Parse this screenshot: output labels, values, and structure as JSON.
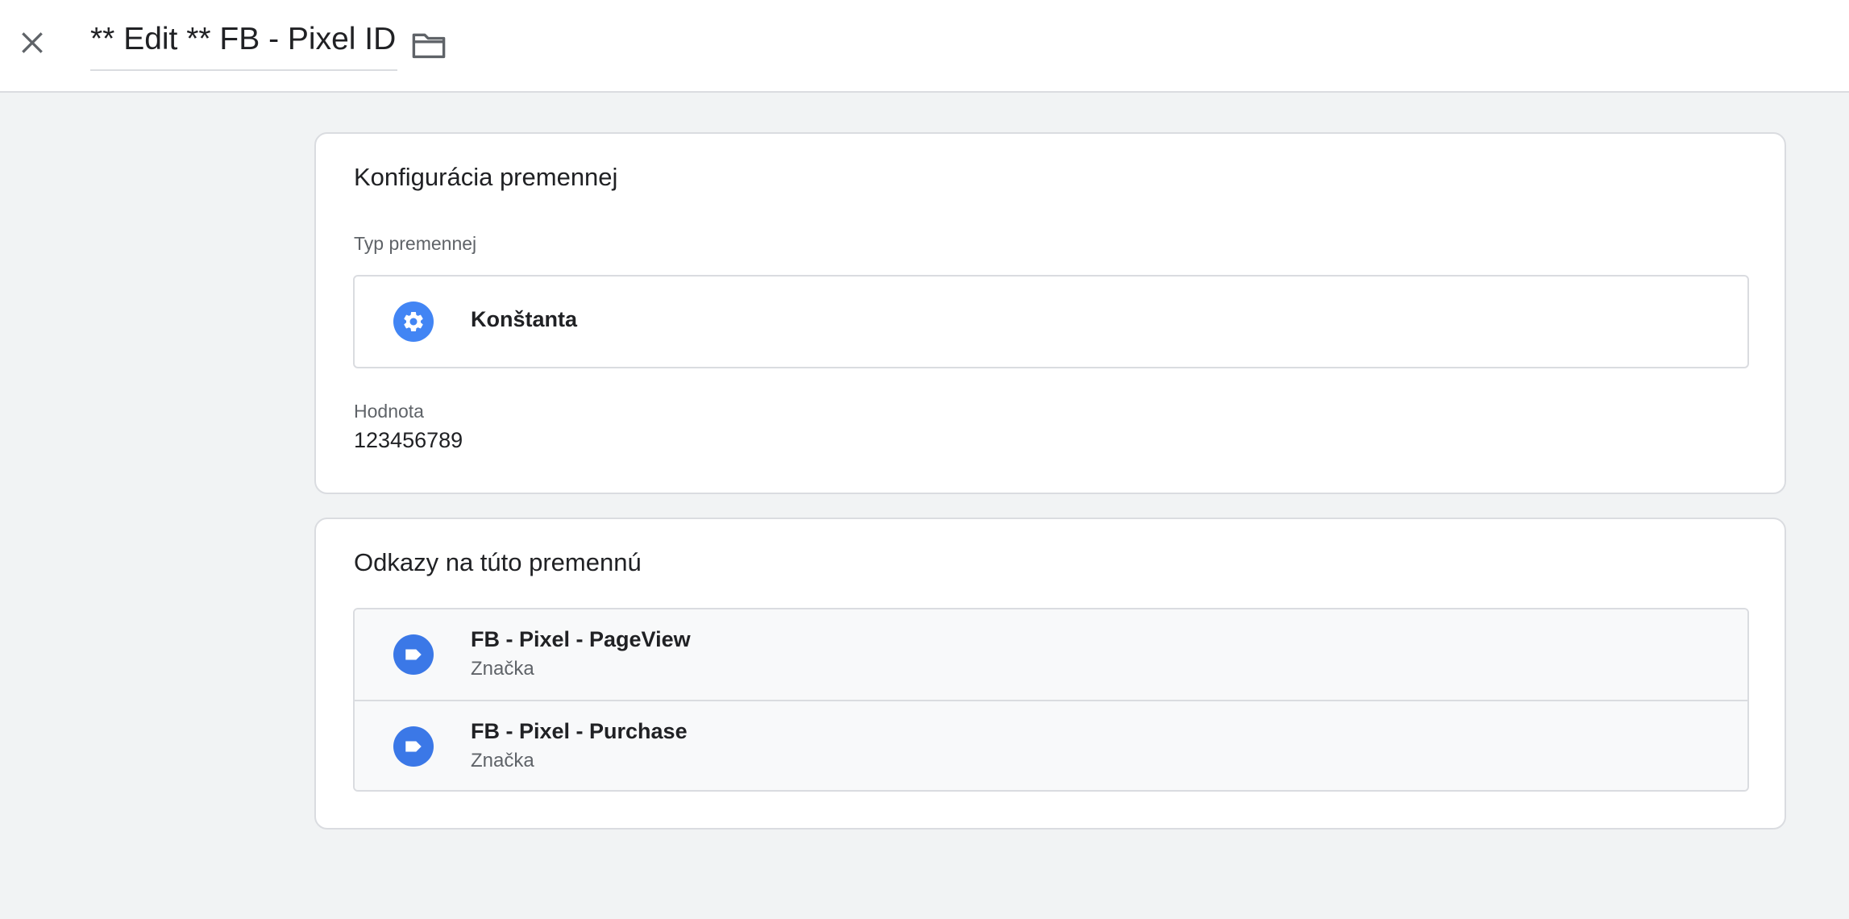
{
  "header": {
    "title": "** Edit ** FB - Pixel ID",
    "close_icon": "close-icon",
    "folder_icon": "folder-icon"
  },
  "config": {
    "title": "Konfigurácia premennej",
    "type_label": "Typ premennej",
    "type_name": "Konštanta",
    "type_icon": "gear-icon",
    "value_label": "Hodnota",
    "value": "123456789"
  },
  "references": {
    "title": "Odkazy na túto premennú",
    "items": [
      {
        "name": "FB - Pixel - PageView",
        "kind": "Značka",
        "icon": "tag-icon"
      },
      {
        "name": "FB - Pixel - Purchase",
        "kind": "Značka",
        "icon": "tag-icon"
      }
    ]
  },
  "colors": {
    "accent_blue": "#4285f4",
    "tag_blue": "#3b78e7",
    "background": "#f1f3f4",
    "border": "#dadce0"
  }
}
